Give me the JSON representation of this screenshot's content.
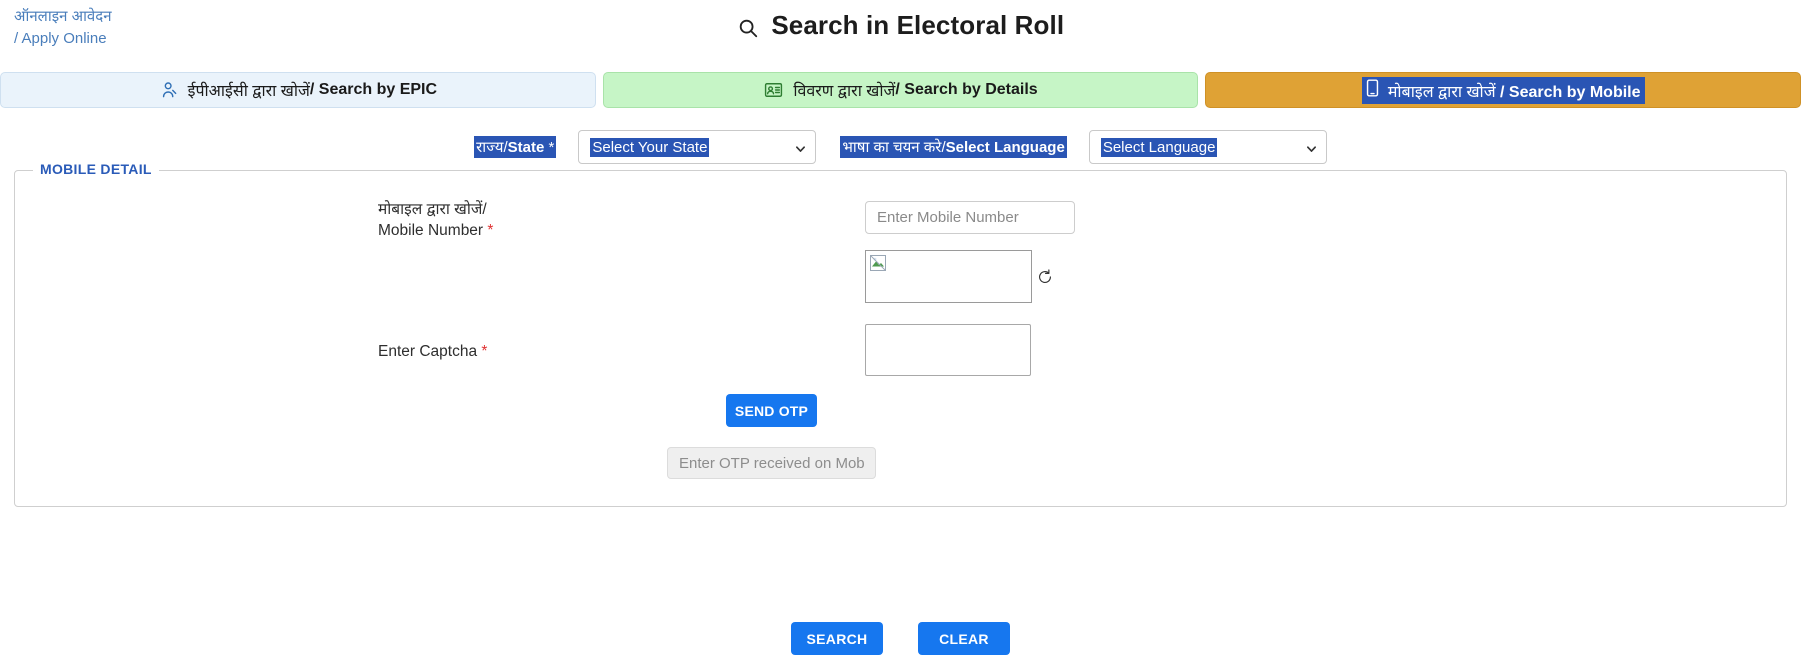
{
  "header": {
    "apply_online_hi": "ऑनलाइन आवेदन",
    "apply_online_en": "/ Apply Online",
    "title": "Search in Electoral Roll",
    "search_icon": "magnifier-icon"
  },
  "tabs": [
    {
      "id": "epic",
      "hi": "ईपीआईसी द्वारा खोजें",
      "en": "/ Search by EPIC",
      "icon": "person-search-icon",
      "active": false,
      "bg": "#eaf3fb"
    },
    {
      "id": "details",
      "hi": "विवरण द्वारा खोजें",
      "en": "/ Search by Details",
      "icon": "id-card-icon",
      "active": false,
      "bg": "#c6f5c6"
    },
    {
      "id": "mobile",
      "hi": "मोबाइल द्वारा खोजें",
      "en": " / Search by Mobile",
      "icon": "mobile-phone-icon",
      "active": true,
      "bg": "#dfa235",
      "selected": true
    }
  ],
  "selectors": {
    "state_label_hi": "राज्य/",
    "state_label_en": "State",
    "state_required": "*",
    "state_value": "Select Your State",
    "language_label_hi": "भाषा का चयन करे/",
    "language_label_en": "Select Language",
    "language_value": "Select Language",
    "chevron_icon": "chevron-down-icon"
  },
  "fieldset": {
    "legend": "MOBILE DETAIL",
    "mobile": {
      "label_hi": "मोबाइल द्वारा खोजें/",
      "label_en": "Mobile Number",
      "required": "*",
      "placeholder": "Enter Mobile Number",
      "value": ""
    },
    "captcha": {
      "image_icon": "broken-image-icon",
      "refresh_icon": "refresh-icon",
      "label_en": "Enter Captcha",
      "required": "*",
      "value": "",
      "placeholder": ""
    },
    "send_otp_label": "SEND OTP",
    "otp": {
      "placeholder": "Enter OTP received on Mobile",
      "value": "",
      "disabled": true
    }
  },
  "footer": {
    "search_label": "SEARCH",
    "clear_label": "CLEAR"
  },
  "colors": {
    "primary_blue": "#1677ef",
    "selection_blue": "#2a55b4",
    "tab_orange": "#dfa235",
    "tab_green": "#c6f5c6",
    "tab_blue": "#eaf3fb",
    "legend_blue": "#2a5bb8",
    "required_red": "#e03131",
    "link_blue": "#4a7ebb"
  }
}
